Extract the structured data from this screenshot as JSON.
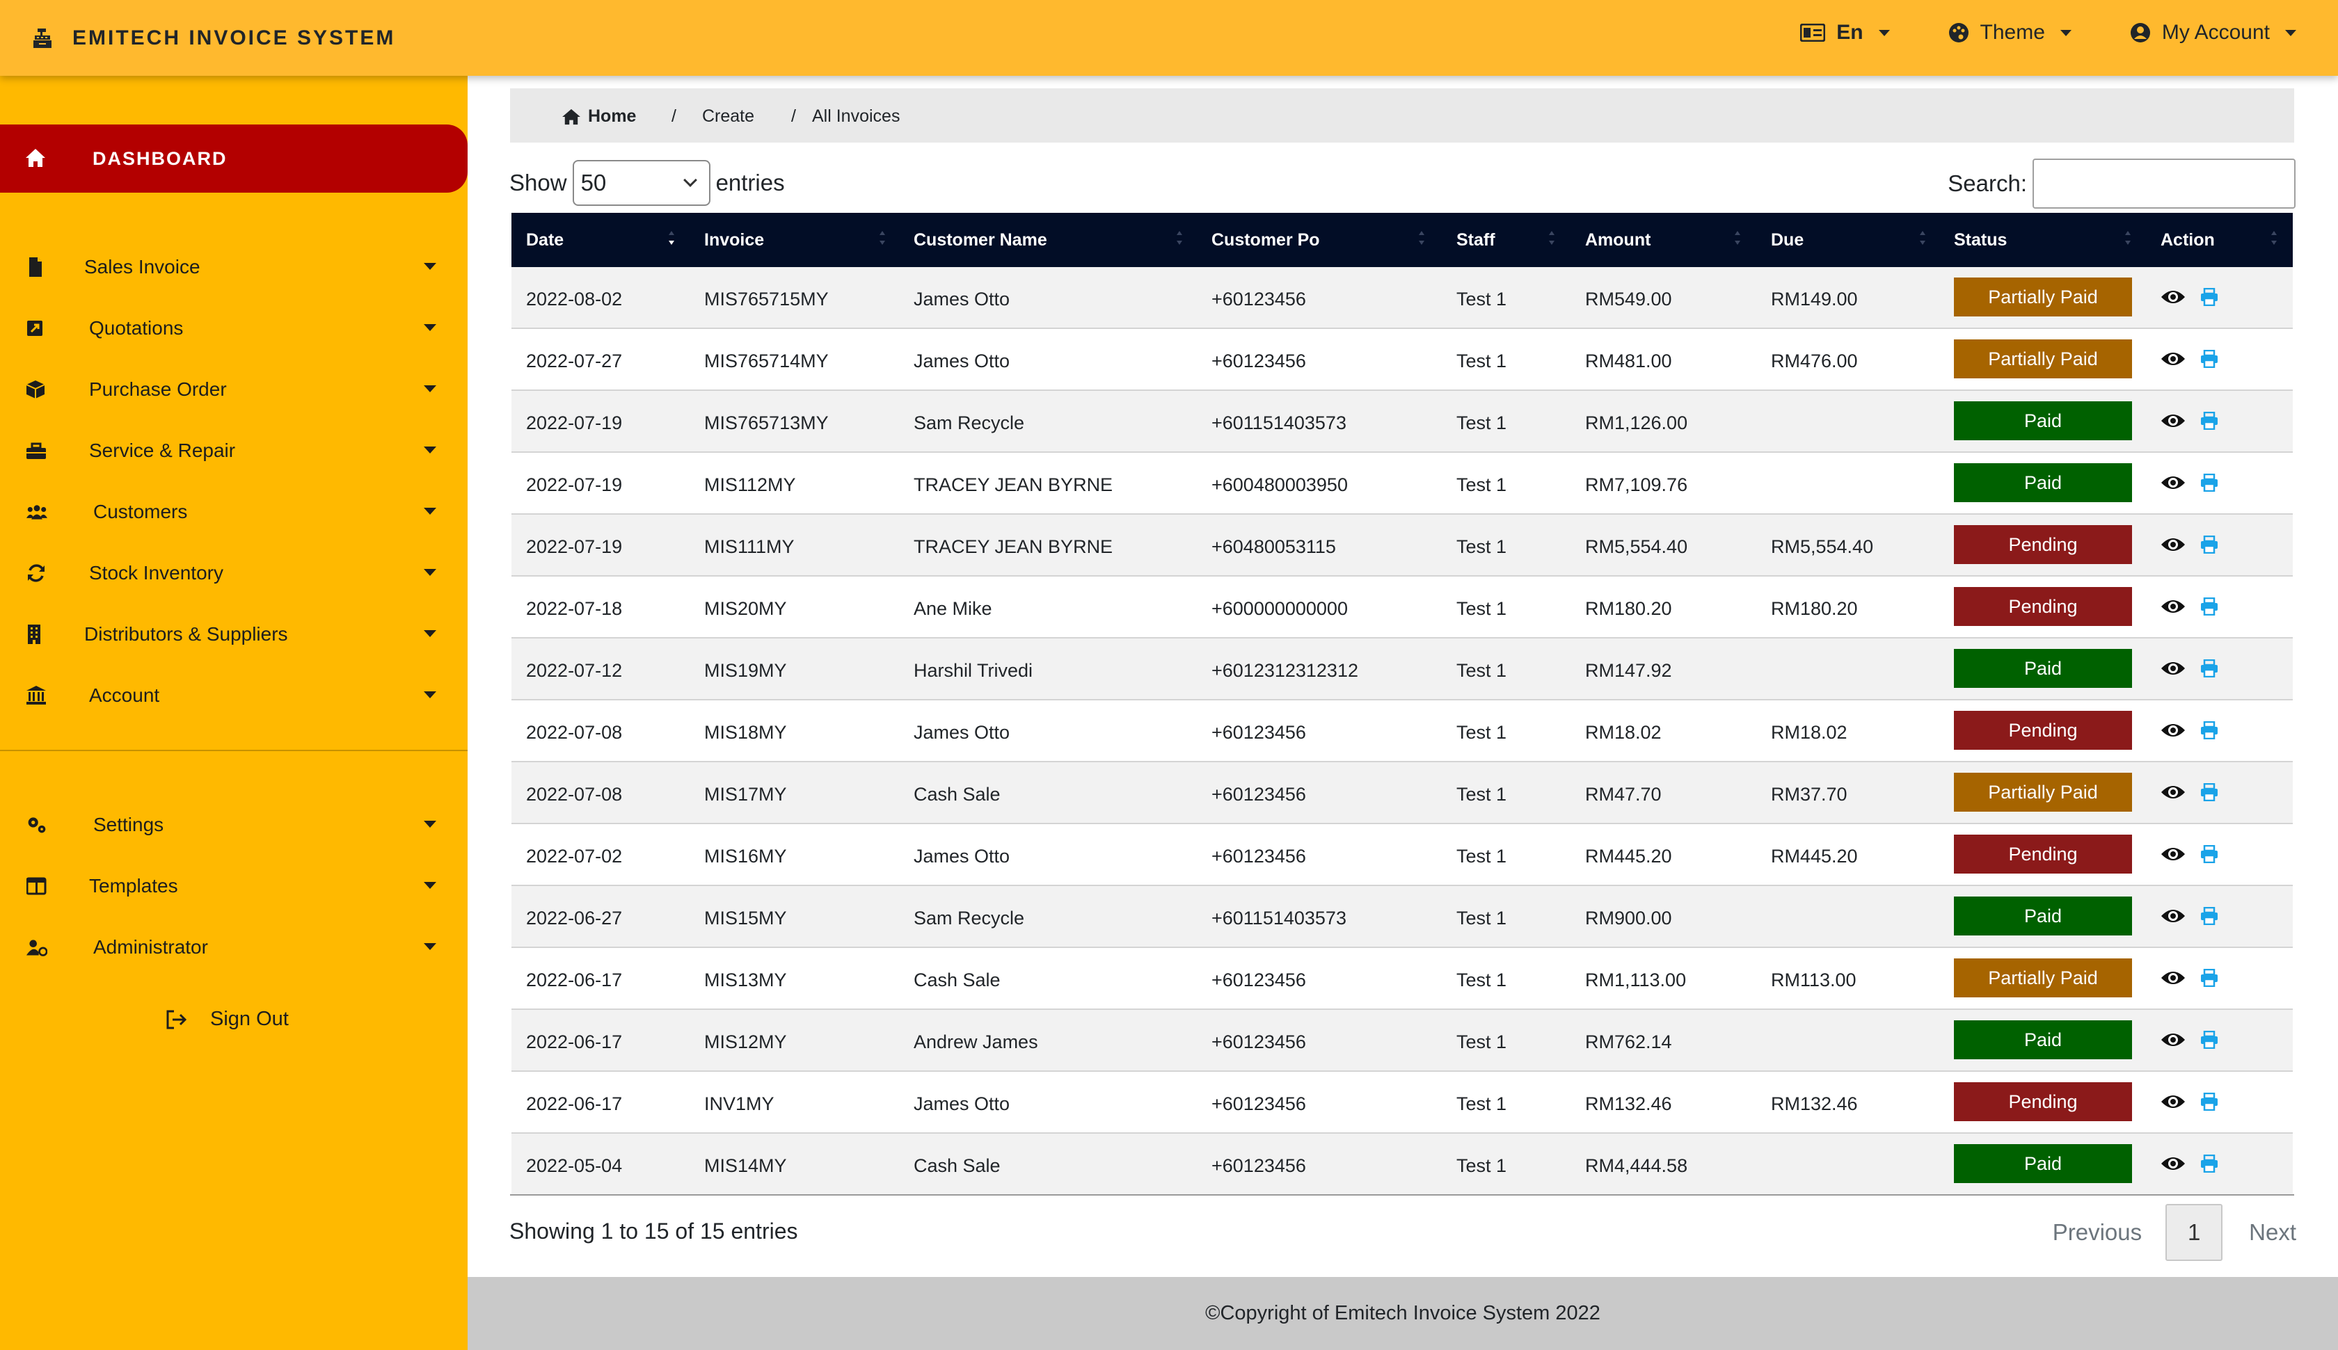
{
  "app": {
    "title": "EMITECH INVOICE SYSTEM",
    "language": "En",
    "theme_label": "Theme",
    "account_label": "My Account"
  },
  "sidebar": {
    "dashboard": "DASHBOARD",
    "items": [
      {
        "label": "Sales Invoice",
        "icon": "file-icon"
      },
      {
        "label": "Quotations",
        "icon": "quote-icon"
      },
      {
        "label": "Purchase Order",
        "icon": "box-icon"
      },
      {
        "label": "Service & Repair",
        "icon": "toolbox-icon"
      },
      {
        "label": "Customers",
        "icon": "users-icon"
      },
      {
        "label": "Stock Inventory",
        "icon": "sync-icon"
      },
      {
        "label": "Distributors & Suppliers",
        "icon": "building-icon"
      },
      {
        "label": "Account",
        "icon": "bank-icon"
      }
    ],
    "bottom_items": [
      {
        "label": "Settings",
        "icon": "gears-icon"
      },
      {
        "label": "Templates",
        "icon": "columns-icon"
      },
      {
        "label": "Administrator",
        "icon": "user-cog-icon"
      }
    ],
    "sign_out": "Sign Out"
  },
  "breadcrumb": {
    "home": "Home",
    "sep": "/",
    "create": "Create",
    "all_invoices": "All Invoices"
  },
  "table_controls": {
    "show_label": "Show",
    "entries_value": "50",
    "entries_label": "entries",
    "search_label": "Search:",
    "search_value": ""
  },
  "table": {
    "columns": [
      "Date",
      "Invoice",
      "Customer Name",
      "Customer Po",
      "Staff",
      "Amount",
      "Due",
      "Status",
      "Action"
    ],
    "rows": [
      {
        "date": "2022-08-02",
        "invoice": "MIS765715MY",
        "customer": "James Otto",
        "po": "+60123456",
        "staff": "Test 1",
        "amount": "RM549.00",
        "due": "RM149.00",
        "status": "Partially Paid"
      },
      {
        "date": "2022-07-27",
        "invoice": "MIS765714MY",
        "customer": "James Otto",
        "po": "+60123456",
        "staff": "Test 1",
        "amount": "RM481.00",
        "due": "RM476.00",
        "status": "Partially Paid"
      },
      {
        "date": "2022-07-19",
        "invoice": "MIS765713MY",
        "customer": "Sam Recycle",
        "po": "+601151403573",
        "staff": "Test 1",
        "amount": "RM1,126.00",
        "due": "",
        "status": "Paid"
      },
      {
        "date": "2022-07-19",
        "invoice": "MIS112MY",
        "customer": "TRACEY JEAN BYRNE",
        "po": "+600480003950",
        "staff": "Test 1",
        "amount": "RM7,109.76",
        "due": "",
        "status": "Paid"
      },
      {
        "date": "2022-07-19",
        "invoice": "MIS111MY",
        "customer": "TRACEY JEAN BYRNE",
        "po": "+60480053115",
        "staff": "Test 1",
        "amount": "RM5,554.40",
        "due": "RM5,554.40",
        "status": "Pending"
      },
      {
        "date": "2022-07-18",
        "invoice": "MIS20MY",
        "customer": "Ane Mike",
        "po": "+600000000000",
        "staff": "Test 1",
        "amount": "RM180.20",
        "due": "RM180.20",
        "status": "Pending"
      },
      {
        "date": "2022-07-12",
        "invoice": "MIS19MY",
        "customer": "Harshil Trivedi",
        "po": "+6012312312312",
        "staff": "Test 1",
        "amount": "RM147.92",
        "due": "",
        "status": "Paid"
      },
      {
        "date": "2022-07-08",
        "invoice": "MIS18MY",
        "customer": "James Otto",
        "po": "+60123456",
        "staff": "Test 1",
        "amount": "RM18.02",
        "due": "RM18.02",
        "status": "Pending"
      },
      {
        "date": "2022-07-08",
        "invoice": "MIS17MY",
        "customer": "Cash Sale",
        "po": "+60123456",
        "staff": "Test 1",
        "amount": "RM47.70",
        "due": "RM37.70",
        "status": "Partially Paid"
      },
      {
        "date": "2022-07-02",
        "invoice": "MIS16MY",
        "customer": "James Otto",
        "po": "+60123456",
        "staff": "Test 1",
        "amount": "RM445.20",
        "due": "RM445.20",
        "status": "Pending"
      },
      {
        "date": "2022-06-27",
        "invoice": "MIS15MY",
        "customer": "Sam Recycle",
        "po": "+601151403573",
        "staff": "Test 1",
        "amount": "RM900.00",
        "due": "",
        "status": "Paid"
      },
      {
        "date": "2022-06-17",
        "invoice": "MIS13MY",
        "customer": "Cash Sale",
        "po": "+60123456",
        "staff": "Test 1",
        "amount": "RM1,113.00",
        "due": "RM113.00",
        "status": "Partially Paid"
      },
      {
        "date": "2022-06-17",
        "invoice": "MIS12MY",
        "customer": "Andrew James",
        "po": "+60123456",
        "staff": "Test 1",
        "amount": "RM762.14",
        "due": "",
        "status": "Paid"
      },
      {
        "date": "2022-06-17",
        "invoice": "INV1MY",
        "customer": "James Otto",
        "po": "+60123456",
        "staff": "Test 1",
        "amount": "RM132.46",
        "due": "RM132.46",
        "status": "Pending"
      },
      {
        "date": "2022-05-04",
        "invoice": "MIS14MY",
        "customer": "Cash Sale",
        "po": "+60123456",
        "staff": "Test 1",
        "amount": "RM4,444.58",
        "due": "",
        "status": "Paid"
      }
    ]
  },
  "status_colors": {
    "Partially Paid": "#a66400",
    "Paid": "#006100",
    "Pending": "#8b1a1a"
  },
  "colors": {
    "topbar": "#ffb92e",
    "sidebar": "#ffb900",
    "dashboard_active": "#b30000",
    "table_header": "#020d26",
    "print_icon": "#1aa3e8"
  },
  "pagination": {
    "info": "Showing 1 to 15 of 15 entries",
    "previous": "Previous",
    "page": "1",
    "next": "Next"
  },
  "footer": {
    "text": "©Copyright of Emitech Invoice System 2022"
  }
}
